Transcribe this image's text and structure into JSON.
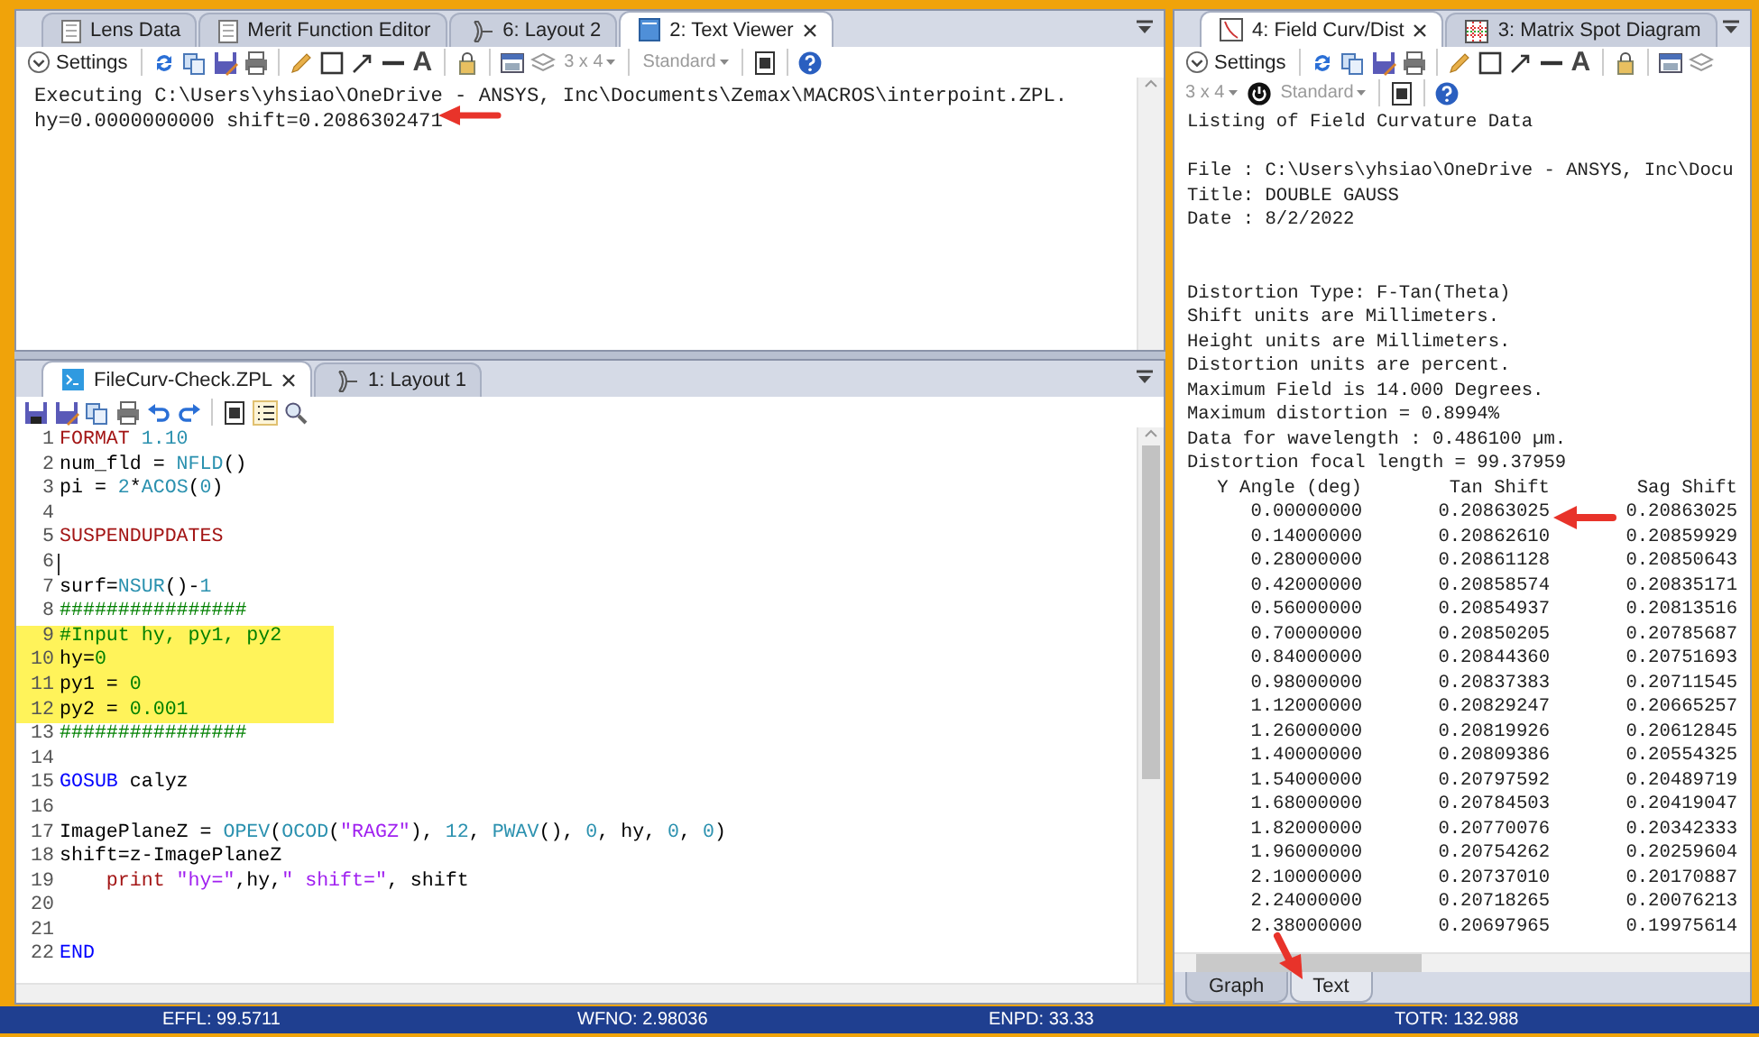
{
  "text_viewer": {
    "tabs": [
      {
        "label": "Lens Data",
        "kind": "editor",
        "selected": false
      },
      {
        "label": "Merit Function Editor",
        "kind": "editor",
        "selected": false
      },
      {
        "label": "6: Layout 2",
        "kind": "layout",
        "selected": false
      },
      {
        "label": "2: Text Viewer",
        "kind": "viewer",
        "selected": true
      }
    ],
    "toolbar": {
      "settings": "Settings",
      "text_tool": "A",
      "grid": {
        "label": "3 x 4",
        "disabled": true
      },
      "preset": {
        "label": "Standard",
        "disabled": true
      }
    },
    "lines": [
      "Executing C:\\Users\\yhsiao\\OneDrive - ANSYS, Inc\\Documents\\Zemax\\MACROS\\interpoint.ZPL.",
      "hy=0.0000000000 shift=0.2086302471"
    ]
  },
  "macro_editor": {
    "tabs": [
      {
        "label": "FileCurv-Check.ZPL",
        "kind": "macro",
        "selected": true
      },
      {
        "label": "1: Layout 1",
        "kind": "layout",
        "selected": false
      }
    ],
    "code": [
      {
        "n": "1",
        "tokens": [
          {
            "kind": "keyword",
            "text": "FORMAT "
          },
          {
            "kind": "number",
            "text": "1.10"
          }
        ]
      },
      {
        "n": "2",
        "tokens": [
          {
            "kind": "plain",
            "text": "num_fld = "
          },
          {
            "kind": "function",
            "text": "NFLD"
          },
          {
            "kind": "plain",
            "text": "()"
          }
        ]
      },
      {
        "n": "3",
        "tokens": [
          {
            "kind": "plain",
            "text": "pi = "
          },
          {
            "kind": "number",
            "text": "2"
          },
          {
            "kind": "plain",
            "text": "*"
          },
          {
            "kind": "function",
            "text": "ACOS"
          },
          {
            "kind": "plain",
            "text": "("
          },
          {
            "kind": "number",
            "text": "0"
          },
          {
            "kind": "plain",
            "text": ")"
          }
        ]
      },
      {
        "n": "4"
      },
      {
        "n": "5",
        "tokens": [
          {
            "kind": "keyword",
            "text": "SUSPENDUPDATES"
          }
        ]
      },
      {
        "n": "6",
        "cursor": true
      },
      {
        "n": "7",
        "tokens": [
          {
            "kind": "plain",
            "text": "surf="
          },
          {
            "kind": "function",
            "text": "NSUR"
          },
          {
            "kind": "plain",
            "text": "()-"
          },
          {
            "kind": "number",
            "text": "1"
          }
        ]
      },
      {
        "n": "8",
        "tokens": [
          {
            "kind": "comment",
            "text": "################"
          }
        ]
      },
      {
        "n": "9",
        "highlighted": true,
        "tokens": [
          {
            "kind": "comment",
            "text": "#Input hy, py1, py2"
          }
        ]
      },
      {
        "n": "10",
        "highlighted": true,
        "tokens": [
          {
            "kind": "plain",
            "text": "hy="
          },
          {
            "kind": "comment",
            "text": "0"
          }
        ]
      },
      {
        "n": "11",
        "highlighted": true,
        "tokens": [
          {
            "kind": "plain",
            "text": "py1 = "
          },
          {
            "kind": "comment",
            "text": "0"
          }
        ]
      },
      {
        "n": "12",
        "highlighted": true,
        "tokens": [
          {
            "kind": "plain",
            "text": "py2 = "
          },
          {
            "kind": "comment",
            "text": "0.001"
          }
        ]
      },
      {
        "n": "13",
        "tokens": [
          {
            "kind": "comment",
            "text": "################"
          }
        ]
      },
      {
        "n": "14"
      },
      {
        "n": "15",
        "tokens": [
          {
            "kind": "control",
            "text": "GOSUB"
          },
          {
            "kind": "plain",
            "text": " calyz"
          }
        ]
      },
      {
        "n": "16"
      },
      {
        "n": "17",
        "tokens": [
          {
            "kind": "plain",
            "text": "ImagePlaneZ = "
          },
          {
            "kind": "function",
            "text": "OPEV"
          },
          {
            "kind": "plain",
            "text": "("
          },
          {
            "kind": "function",
            "text": "OCOD"
          },
          {
            "kind": "plain",
            "text": "("
          },
          {
            "kind": "string",
            "text": "\"RAGZ\""
          },
          {
            "kind": "plain",
            "text": "), "
          },
          {
            "kind": "number",
            "text": "12"
          },
          {
            "kind": "plain",
            "text": ", "
          },
          {
            "kind": "function",
            "text": "PWAV"
          },
          {
            "kind": "plain",
            "text": "(), "
          },
          {
            "kind": "number",
            "text": "0"
          },
          {
            "kind": "plain",
            "text": ", hy, "
          },
          {
            "kind": "number",
            "text": "0"
          },
          {
            "kind": "plain",
            "text": ", "
          },
          {
            "kind": "number",
            "text": "0"
          },
          {
            "kind": "plain",
            "text": ")"
          }
        ]
      },
      {
        "n": "18",
        "tokens": [
          {
            "kind": "plain",
            "text": "shift=z-ImagePlaneZ"
          }
        ]
      },
      {
        "n": "19",
        "tokens": [
          {
            "kind": "keyword",
            "text": "    print "
          },
          {
            "kind": "string",
            "text": "\"hy=\""
          },
          {
            "kind": "plain",
            "text": ",hy,"
          },
          {
            "kind": "string",
            "text": "\" shift=\""
          },
          {
            "kind": "plain",
            "text": ", shift"
          }
        ]
      },
      {
        "n": "20"
      },
      {
        "n": "21"
      },
      {
        "n": "22",
        "tokens": [
          {
            "kind": "control",
            "text": "END"
          }
        ]
      }
    ]
  },
  "field_curvature": {
    "tabs": [
      {
        "label": "4: Field Curv/Dist",
        "kind": "analysis",
        "selected": true
      },
      {
        "label": "3: Matrix Spot Diagram",
        "kind": "matrix",
        "selected": false
      }
    ],
    "toolbar": {
      "settings": "Settings",
      "text_tool": "A",
      "grid": {
        "label": "3 x 4",
        "disabled": true
      },
      "preset": {
        "label": "Standard",
        "disabled": true
      }
    },
    "listing": [
      {
        "kind": "first",
        "lines": [
          "Listing of Field Curvature Data"
        ]
      },
      {
        "kind": "single",
        "lines": [
          "File : C:\\Users\\yhsiao\\OneDrive - ANSYS, Inc\\Docu",
          "Title: DOUBLE GAUSS",
          "Date : 8/2/2022"
        ]
      },
      {
        "kind": "double",
        "lines": [
          "Distortion Type: F-Tan(Theta)",
          "Shift units are Millimeters.",
          "Height units are Millimeters.",
          "Distortion units are percent.",
          "Maximum Field is 14.000 Degrees.",
          "Maximum distortion = 0.8994%",
          "Data for wavelength : 0.486100 µm.",
          "Distortion focal length = 99.37959"
        ]
      }
    ],
    "table": {
      "columns": [
        "Y Angle (deg)",
        "Tan Shift",
        "Sag Shift"
      ],
      "rows": [
        [
          "0.00000000",
          "0.20863025",
          "0.20863025"
        ],
        [
          "0.14000000",
          "0.20862610",
          "0.20859929"
        ],
        [
          "0.28000000",
          "0.20861128",
          "0.20850643"
        ],
        [
          "0.42000000",
          "0.20858574",
          "0.20835171"
        ],
        [
          "0.56000000",
          "0.20854937",
          "0.20813516"
        ],
        [
          "0.70000000",
          "0.20850205",
          "0.20785687"
        ],
        [
          "0.84000000",
          "0.20844360",
          "0.20751693"
        ],
        [
          "0.98000000",
          "0.20837383",
          "0.20711545"
        ],
        [
          "1.12000000",
          "0.20829247",
          "0.20665257"
        ],
        [
          "1.26000000",
          "0.20819926",
          "0.20612845"
        ],
        [
          "1.40000000",
          "0.20809386",
          "0.20554325"
        ],
        [
          "1.54000000",
          "0.20797592",
          "0.20489719"
        ],
        [
          "1.68000000",
          "0.20784503",
          "0.20419047"
        ],
        [
          "1.82000000",
          "0.20770076",
          "0.20342333"
        ],
        [
          "1.96000000",
          "0.20754262",
          "0.20259604"
        ],
        [
          "2.10000000",
          "0.20737010",
          "0.20170887"
        ],
        [
          "2.24000000",
          "0.20718265",
          "0.20076213"
        ],
        [
          "2.38000000",
          "0.20697965",
          "0.19975614"
        ]
      ]
    },
    "view_tabs": [
      {
        "label": "Graph",
        "selected": false
      },
      {
        "label": "Text",
        "selected": true
      }
    ]
  },
  "status_bar": [
    "EFFL: 99.5711",
    "WFNO: 2.98036",
    "ENPD: 33.33",
    "TOTR: 132.988"
  ]
}
